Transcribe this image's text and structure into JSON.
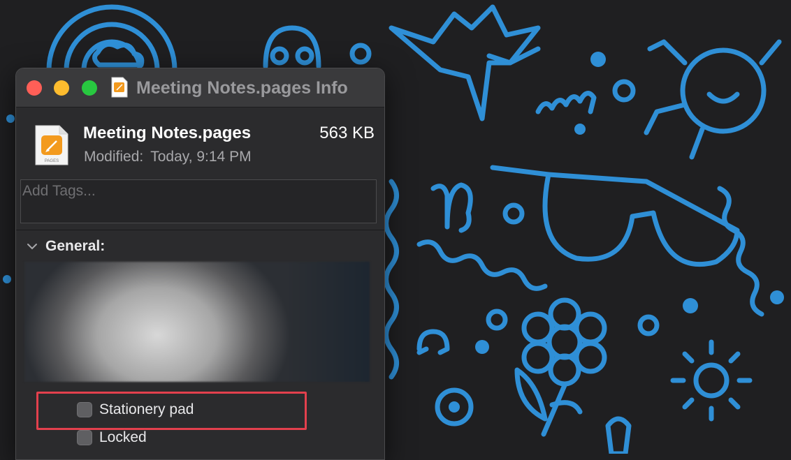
{
  "window": {
    "title": "Meeting Notes.pages Info"
  },
  "file": {
    "name": "Meeting Notes.pages",
    "size": "563 KB",
    "modified_label": "Modified:",
    "modified_value": "Today, 9:14 PM",
    "icon_caption": "PAGES"
  },
  "tags": {
    "placeholder": "Add Tags..."
  },
  "general": {
    "title": "General:",
    "expanded": true
  },
  "options": {
    "stationery_pad": "Stationery pad",
    "locked": "Locked"
  },
  "colors": {
    "accent_orange": "#f39a1e",
    "wallpaper_line": "#2f8fd6",
    "highlight_red": "#e3404d"
  }
}
